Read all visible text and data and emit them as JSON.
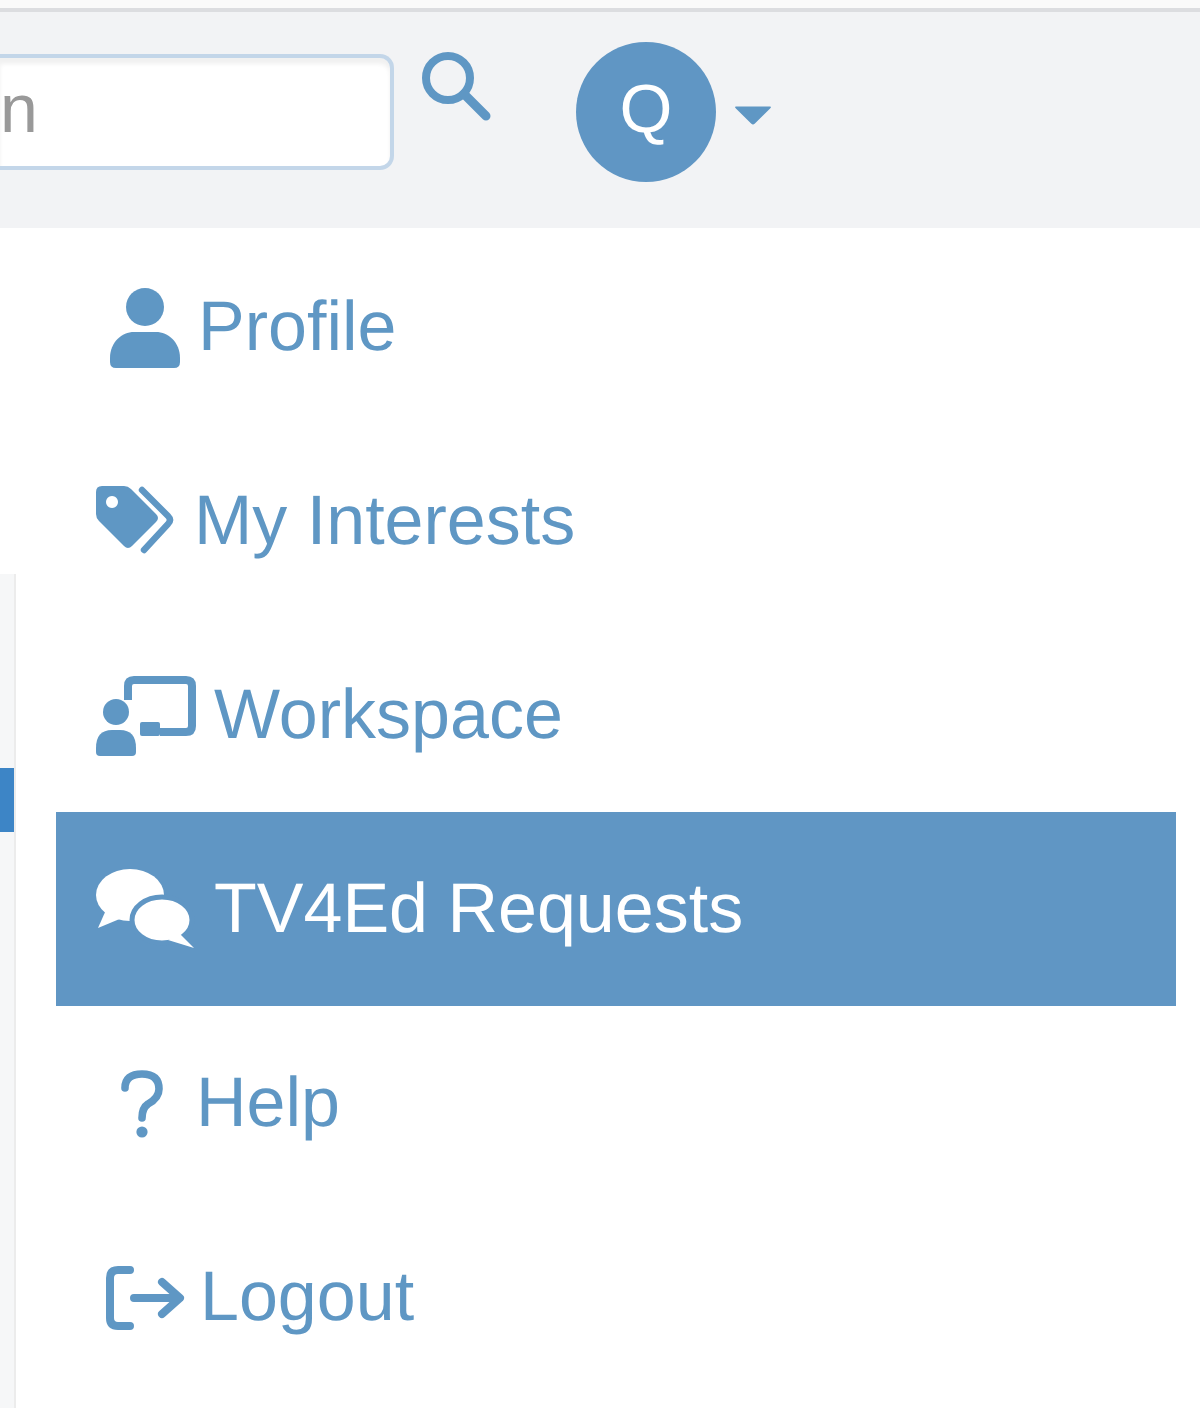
{
  "header": {
    "search": {
      "placeholder": "n"
    },
    "avatar": {
      "initial": "Q"
    }
  },
  "menu": {
    "items": [
      {
        "label": "Profile",
        "selected": false
      },
      {
        "label": "My Interests",
        "selected": false
      },
      {
        "label": "Workspace",
        "selected": false
      },
      {
        "label": "TV4Ed Requests",
        "selected": true
      },
      {
        "label": "Help",
        "selected": false
      },
      {
        "label": "Logout",
        "selected": false
      }
    ]
  }
}
